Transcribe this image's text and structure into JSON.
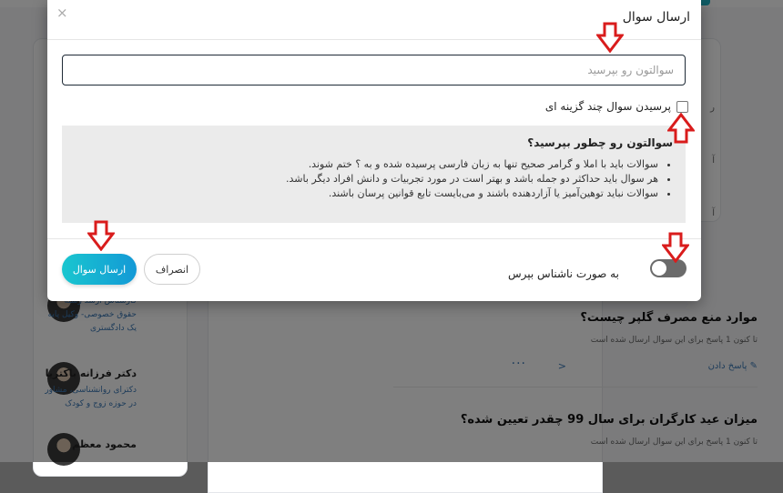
{
  "modal": {
    "title": "ارسال سوال",
    "close_label": "×",
    "question_input": {
      "value": "",
      "placeholder": "سوالتون رو بپرسید"
    },
    "multiple_choice_label": "پرسیدن سوال چند گزینه ای",
    "guide": {
      "title": "سوالتون رو چطور بپرسید؟",
      "rules": [
        "سوالات باید با املا و گرامر صحیح تنها به زبان فارسی پرسیده شده و به ؟ ختم شوند.",
        "هر سوال باید حداکثر دو جمله باشد و بهتر است در مورد تجربیات و دانش افراد دیگر باشد.",
        "سوالات نباید توهین‌آمیز یا آزاردهنده باشند و می‌بایست تابع قوانین پرسان باشند."
      ]
    },
    "anonymous_label": "به صورت ناشناس بپرس",
    "anonymous_on": false,
    "cancel_label": "انصراف",
    "submit_label": "ارسال سوال"
  },
  "background": {
    "experts": [
      {
        "name": "",
        "desc": "کارشناس ارشد رشته حقوق خصوصی- وکیل پایه یک دادگستری"
      },
      {
        "name": "دکتر فرزانه باکتریا",
        "desc": "دکترای روانشناسی، مشاور در حوزه زوج و کودک"
      },
      {
        "name": "محمود معظم",
        "desc": ""
      }
    ],
    "questions": [
      {
        "title": "موارد منع مصرف گلپر چیست؟",
        "meta": "تا کنون 1 پاسخ برای این سوال ارسال شده است",
        "answer_label": "پاسخ دادن"
      },
      {
        "title": "میزان عید کارگران برای سال 99 چقدر تعیین شده؟",
        "meta": "تا کنون 1 پاسخ برای این سوال ارسال شده است",
        "answer_label": "پاسخ دادن"
      }
    ],
    "right_card_letters": [
      "ر",
      "آ",
      "آ"
    ]
  },
  "colors": {
    "accent": "#1fb7c9",
    "primary_button": "#1399d6",
    "annotation_arrow": "#d91c1c"
  }
}
